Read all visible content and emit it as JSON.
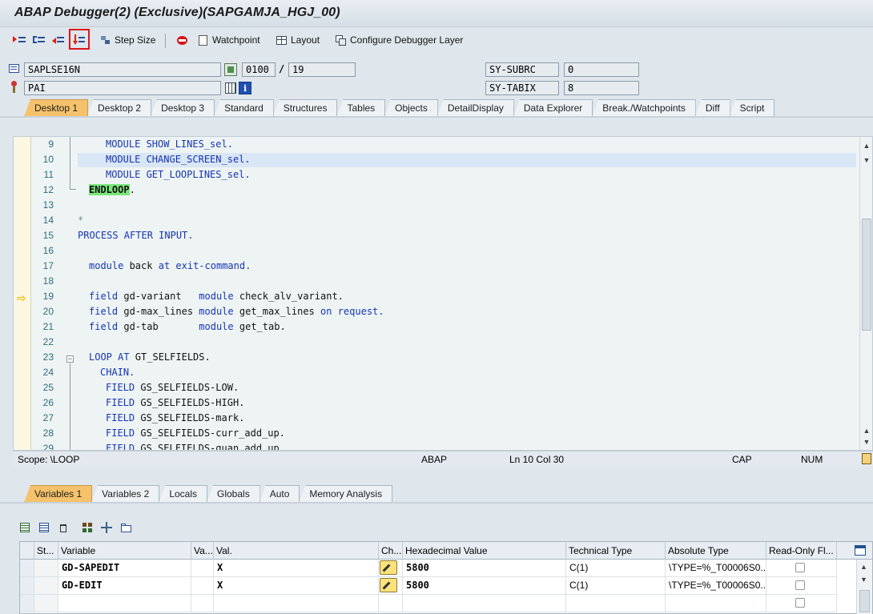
{
  "window": {
    "title": "ABAP Debugger(2)  (Exclusive)(SAPGAMJA_HGJ_00)"
  },
  "toolbar": {
    "step_size_label": "Step Size",
    "watchpoint_label": "Watchpoint",
    "layout_label": "Layout",
    "configure_label": "Configure Debugger Layer"
  },
  "header": {
    "program": "SAPLSE16N",
    "event": "PAI",
    "screen": "0100",
    "slash": "/",
    "screen_line": "19",
    "sy_subrc_label": "SY-SUBRC",
    "sy_subrc_value": "0",
    "sy_tabix_label": "SY-TABIX",
    "sy_tabix_value": "8"
  },
  "desktop_tabs": [
    "Desktop 1",
    "Desktop 2",
    "Desktop 3",
    "Standard",
    "Structures",
    "Tables",
    "Objects",
    "DetailDisplay",
    "Data Explorer",
    "Break./Watchpoints",
    "Diff",
    "Script"
  ],
  "code": {
    "line_numbers": [
      "9",
      "10",
      "11",
      "12",
      "13",
      "14",
      "15",
      "16",
      "17",
      "18",
      "19",
      "20",
      "21",
      "22",
      "23",
      "24",
      "25",
      "26",
      "27",
      "28",
      "29"
    ],
    "l9": "MODULE SHOW_LINES_sel.",
    "l10": "MODULE CHANGE_SCREEN_sel.",
    "l11": "MODULE GET_LOOPLINES_sel.",
    "l12": "ENDLOOP",
    "l12_dot": ".",
    "l14": "*",
    "l15": "PROCESS AFTER INPUT.",
    "l17_kw1": "module",
    "l17_mid": " back ",
    "l17_kw2": "at exit-command.",
    "l19_kw1": "field",
    "l19_mid": " gd-variant   ",
    "l19_kw2": "module",
    "l19_end": " check_alv_variant.",
    "l20_kw1": "field",
    "l20_mid": " gd-max_lines ",
    "l20_kw2": "module",
    "l20_mid2": " get_max_lines ",
    "l20_kw3": "on request.",
    "l21_kw1": "field",
    "l21_mid": " gd-tab       ",
    "l21_kw2": "module",
    "l21_end": " get_tab.",
    "l23_kw": "LOOP AT",
    "l23_end": " GT_SELFIELDS.",
    "l24": "CHAIN.",
    "l25_kw": "FIELD",
    "l25_end": " GS_SELFIELDS-LOW.",
    "l26_kw": "FIELD",
    "l26_end": " GS_SELFIELDS-HIGH.",
    "l27_kw": "FIELD",
    "l27_end": " GS_SELFIELDS-mark.",
    "l28_kw": "FIELD",
    "l28_end": " GS_SELFIELDS-curr_add_up.",
    "l29_kw": "FIELD",
    "l29_end": " GS_SELFIELDS-quan_add_up."
  },
  "status": {
    "scope": "Scope: \\LOOP",
    "lang": "ABAP",
    "position": "Ln  10 Col  30",
    "cap": "CAP",
    "num": "NUM"
  },
  "variable_tabs": [
    "Variables 1",
    "Variables 2",
    "Locals",
    "Globals",
    "Auto",
    "Memory Analysis"
  ],
  "grid": {
    "headers": [
      "St...",
      "Variable",
      "Va...",
      "Val.",
      "Ch...",
      "Hexadecimal Value",
      "Technical Type",
      "Absolute Type",
      "Read-Only Fl..."
    ],
    "rows": [
      {
        "variable": "GD-SAPEDIT",
        "value": "X",
        "hex": "5800",
        "tech": "C(1)",
        "abs": "\\TYPE=%_T00006S0..."
      },
      {
        "variable": "GD-EDIT",
        "value": "X",
        "hex": "5800",
        "tech": "C(1)",
        "abs": "\\TYPE=%_T00006S0..."
      }
    ]
  },
  "colors": {
    "active_tab": "#f5c26b",
    "keyword": "#1535b3",
    "endloop_highlight": "#7ae67a",
    "breakpoint_marker": "#e8c000"
  }
}
